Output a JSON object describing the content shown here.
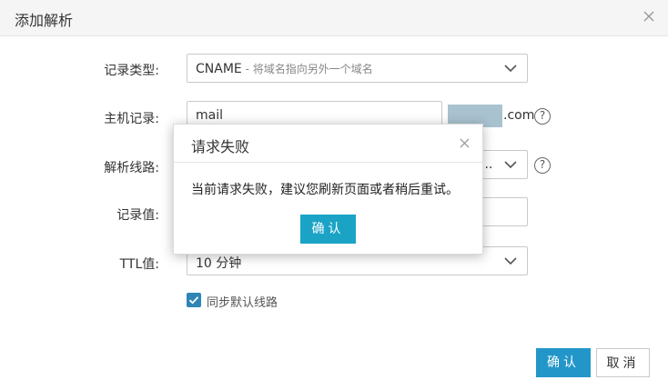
{
  "dialog": {
    "title": "添加解析",
    "fields": {
      "record_type": {
        "label": "记录类型:",
        "value": "CNAME",
        "hint": " - 将域名指向另外一个域名"
      },
      "host": {
        "label": "主机记录:",
        "value": "mail",
        "suffix": ".com"
      },
      "line": {
        "label": "解析线路:",
        "value": "..."
      },
      "record_value": {
        "label": "记录值:",
        "value": ""
      },
      "ttl": {
        "label": "TTL值:",
        "value": "10 分钟"
      }
    },
    "sync_checkbox": {
      "label": "同步默认线路",
      "checked": true
    },
    "buttons": {
      "confirm": "确认",
      "cancel": "取消"
    },
    "help_glyph": "?"
  },
  "modal": {
    "title": "请求失败",
    "message": "当前请求失败，建议您刷新页面或者稍后重试。",
    "confirm": "确认"
  },
  "colors": {
    "primary": "#2296c9",
    "modal_button": "#1ba3c6",
    "checkbox": "#2e86b6"
  }
}
